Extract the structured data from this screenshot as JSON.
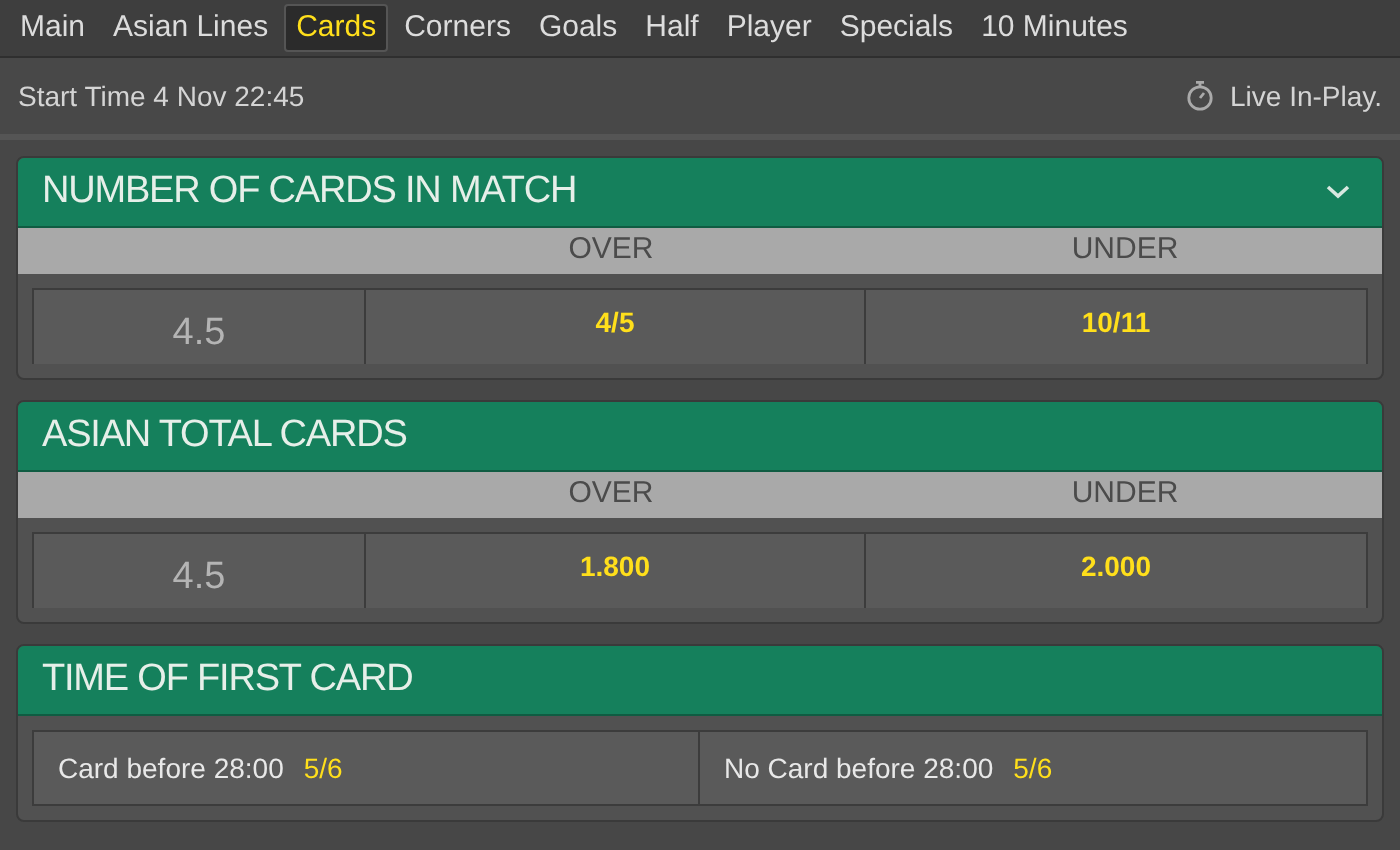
{
  "tabs": [
    {
      "label": "Main",
      "selected": false
    },
    {
      "label": "Asian Lines",
      "selected": false
    },
    {
      "label": "Cards",
      "selected": true
    },
    {
      "label": "Corners",
      "selected": false
    },
    {
      "label": "Goals",
      "selected": false
    },
    {
      "label": "Half",
      "selected": false
    },
    {
      "label": "Player",
      "selected": false
    },
    {
      "label": "Specials",
      "selected": false
    },
    {
      "label": "10 Minutes",
      "selected": false
    }
  ],
  "info_bar": {
    "start_time": "Start Time 4 Nov 22:45",
    "live_label": "Live In-Play."
  },
  "markets": [
    {
      "kind": "table",
      "title": "NUMBER OF CARDS IN MATCH",
      "collapsible": true,
      "columns": [
        "OVER",
        "UNDER"
      ],
      "rows": [
        {
          "line": "4.5",
          "odds": [
            "4/5",
            "10/11"
          ]
        }
      ]
    },
    {
      "kind": "table",
      "title": "ASIAN TOTAL CARDS",
      "collapsible": false,
      "columns": [
        "OVER",
        "UNDER"
      ],
      "rows": [
        {
          "line": "4.5",
          "odds": [
            "1.800",
            "2.000"
          ]
        }
      ]
    },
    {
      "kind": "selections",
      "title": "TIME OF FIRST CARD",
      "collapsible": false,
      "selections": [
        {
          "label": "Card before 28:00",
          "odds": "5/6"
        },
        {
          "label": "No Card before 28:00",
          "odds": "5/6"
        }
      ]
    }
  ]
}
